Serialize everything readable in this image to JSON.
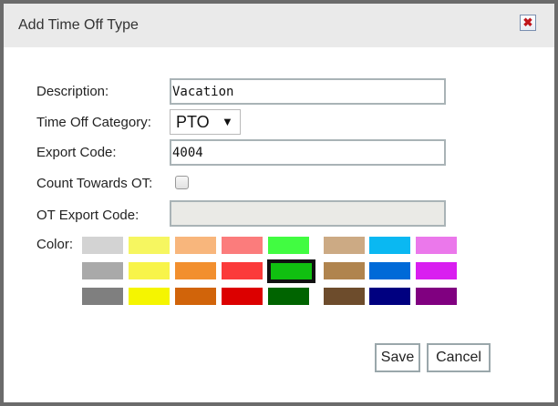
{
  "dialog": {
    "title": "Add Time Off Type",
    "close_icon": "close-x-icon"
  },
  "form": {
    "description_label": "Description:",
    "description_value": "Vacation",
    "category_label": "Time Off Category:",
    "category_value": "PTO",
    "category_arrow": "▼",
    "export_code_label": "Export Code:",
    "export_code_value": "4004",
    "count_ot_label": "Count Towards OT:",
    "count_ot_checked": false,
    "ot_export_label": "OT Export Code:",
    "ot_export_value": "",
    "color_label": "Color:"
  },
  "colors": {
    "selected": "#10c010",
    "swatches": [
      [
        "#d3d3d3",
        "#f6f660",
        "#f8b67c",
        "#fb7c7c",
        "#41fc41",
        "#ccaa84",
        "#0ab8f2",
        "#eb78eb"
      ],
      [
        "#a9a9a9",
        "#f8f44a",
        "#f28f2e",
        "#fb3a3a",
        "#10c010",
        "#b0844e",
        "#006ad8",
        "#d91ef0"
      ],
      [
        "#7f7f7f",
        "#f5f500",
        "#d1640a",
        "#dc0000",
        "#006400",
        "#6d4c2c",
        "#000080",
        "#800080"
      ]
    ]
  },
  "buttons": {
    "save": "Save",
    "cancel": "Cancel"
  }
}
